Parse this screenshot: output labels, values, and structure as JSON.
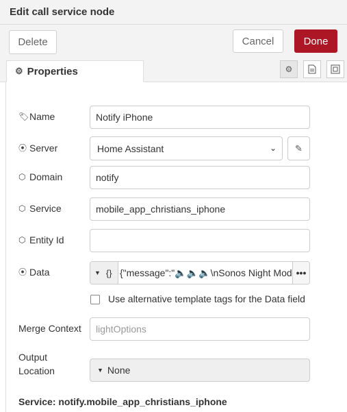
{
  "header": {
    "title": "Edit call service node"
  },
  "toolbar": {
    "delete_label": "Delete",
    "cancel_label": "Cancel",
    "done_label": "Done"
  },
  "tabs": {
    "properties_label": "Properties"
  },
  "form": {
    "name": {
      "label": "Name",
      "value": "Notify iPhone"
    },
    "server": {
      "label": "Server",
      "value": "Home Assistant"
    },
    "domain": {
      "label": "Domain",
      "value": "notify"
    },
    "service": {
      "label": "Service",
      "value": "mobile_app_christians_iphone"
    },
    "entity_id": {
      "label": "Entity Id",
      "value": ""
    },
    "data": {
      "label": "Data",
      "type_label": "{}",
      "value": "{\"message\":\"🔈🔈🔈\\nSonos Night Mode"
    },
    "alt_template": {
      "label": "Use alternative template tags for the Data field",
      "checked": false
    },
    "merge_context": {
      "label": "Merge Context",
      "placeholder": "lightOptions"
    },
    "output_location": {
      "label_line1": "Output",
      "label_line2": "Location",
      "value": "None"
    }
  },
  "footer": {
    "service_text": "Service: notify.mobile_app_christians_iphone"
  },
  "colors": {
    "done": "#ad1625",
    "panel_bg": "#f3f3f3",
    "border": "#cccccc"
  }
}
